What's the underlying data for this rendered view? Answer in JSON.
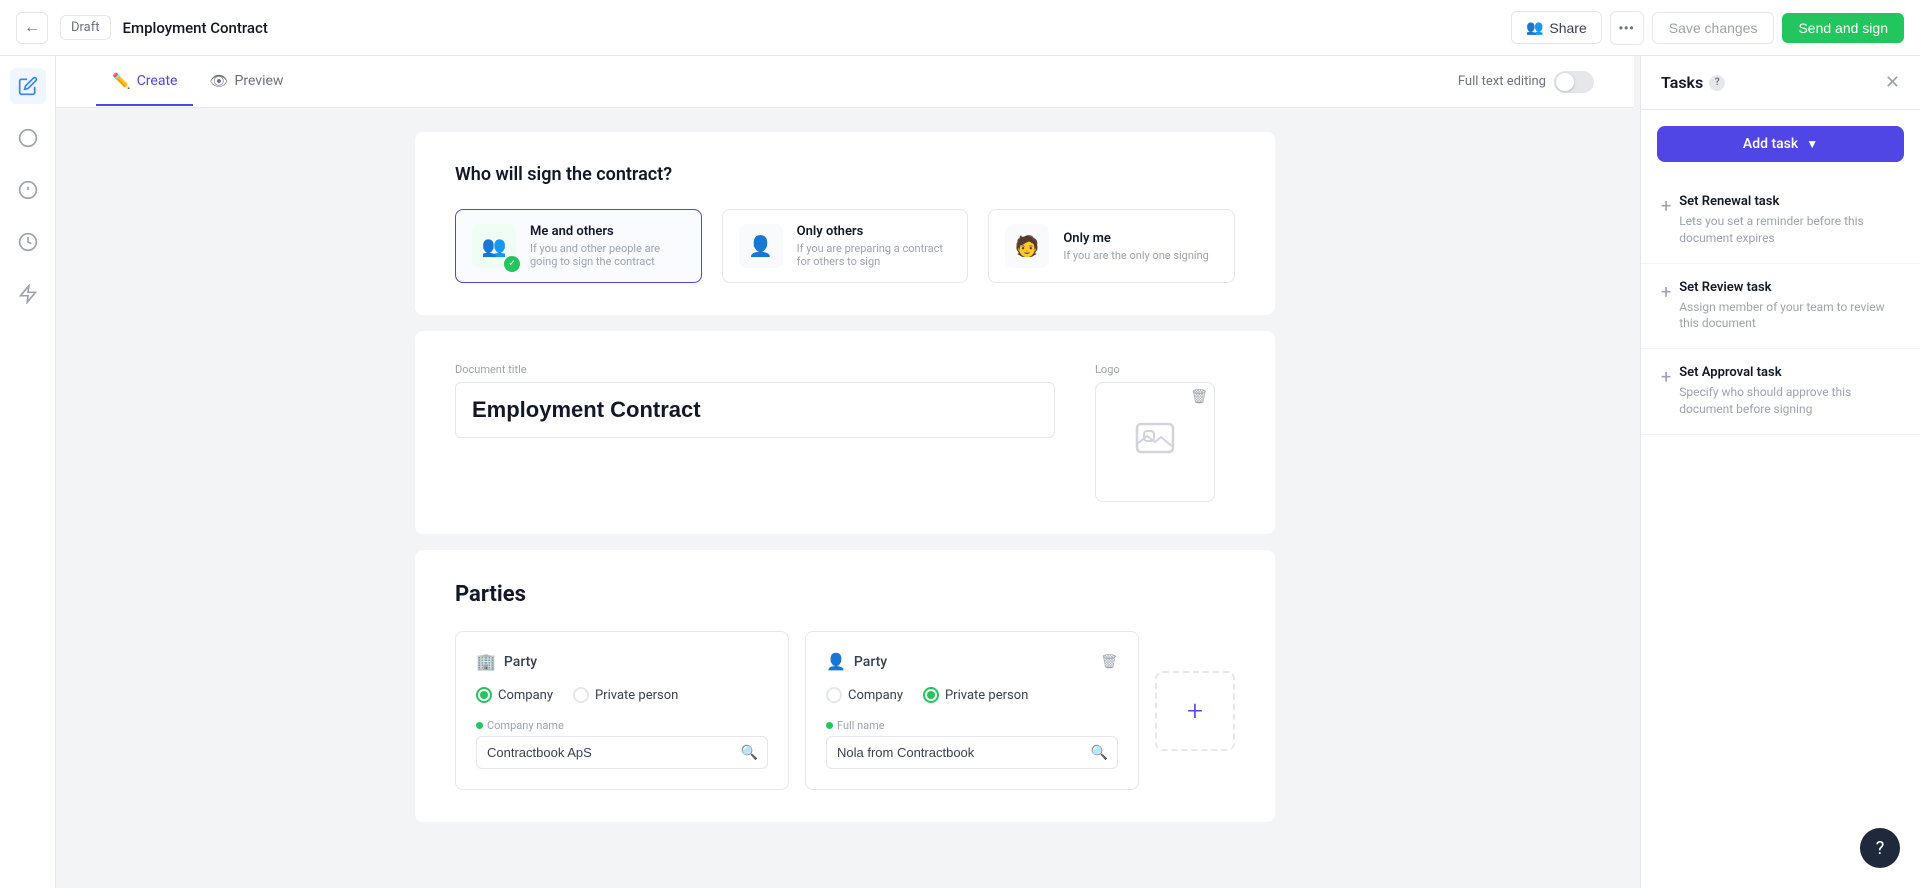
{
  "topbar": {
    "back_label": "←",
    "draft_label": "Draft",
    "document_title": "Employment Contract",
    "share_label": "Share",
    "more_label": "•••",
    "save_label": "Save changes",
    "send_label": "Send and sign"
  },
  "tabs": {
    "create_label": "Create",
    "preview_label": "Preview",
    "full_text_label": "Full text editing"
  },
  "signing_section": {
    "title": "Who will sign the contract?",
    "options": [
      {
        "id": "me-and-others",
        "title": "Me and others",
        "description": "If you and other people are going to sign the contract",
        "selected": true
      },
      {
        "id": "only-others",
        "title": "Only others",
        "description": "If you are preparing a contract for others to sign",
        "selected": false
      },
      {
        "id": "only-me",
        "title": "Only me",
        "description": "If you are the only one signing",
        "selected": false
      }
    ]
  },
  "document_form": {
    "title_label": "Document title",
    "title_value": "Employment Contract",
    "logo_label": "Logo"
  },
  "parties_section": {
    "title": "Parties",
    "party1": {
      "label": "Party",
      "type_company": "Company",
      "type_private": "Private person",
      "selected_type": "company",
      "field_label": "Company name",
      "field_value": "Contractbook ApS",
      "field_placeholder": "Company name"
    },
    "party2": {
      "label": "Party",
      "type_company": "Company",
      "type_private": "Private person",
      "selected_type": "private",
      "field_label": "Full name",
      "field_value": "Nola from Contractbook",
      "field_placeholder": "Full name"
    },
    "add_party_label": "+"
  },
  "tasks_panel": {
    "title": "Tasks",
    "add_task_label": "Add task",
    "tasks": [
      {
        "id": "renewal",
        "title": "Set Renewal task",
        "description": "Lets you set a reminder before this document expires"
      },
      {
        "id": "review",
        "title": "Set Review task",
        "description": "Assign member of your team to review this document"
      },
      {
        "id": "approval",
        "title": "Set Approval task",
        "description": "Specify who should approve this document before signing"
      }
    ]
  },
  "help": {
    "label": "?"
  }
}
